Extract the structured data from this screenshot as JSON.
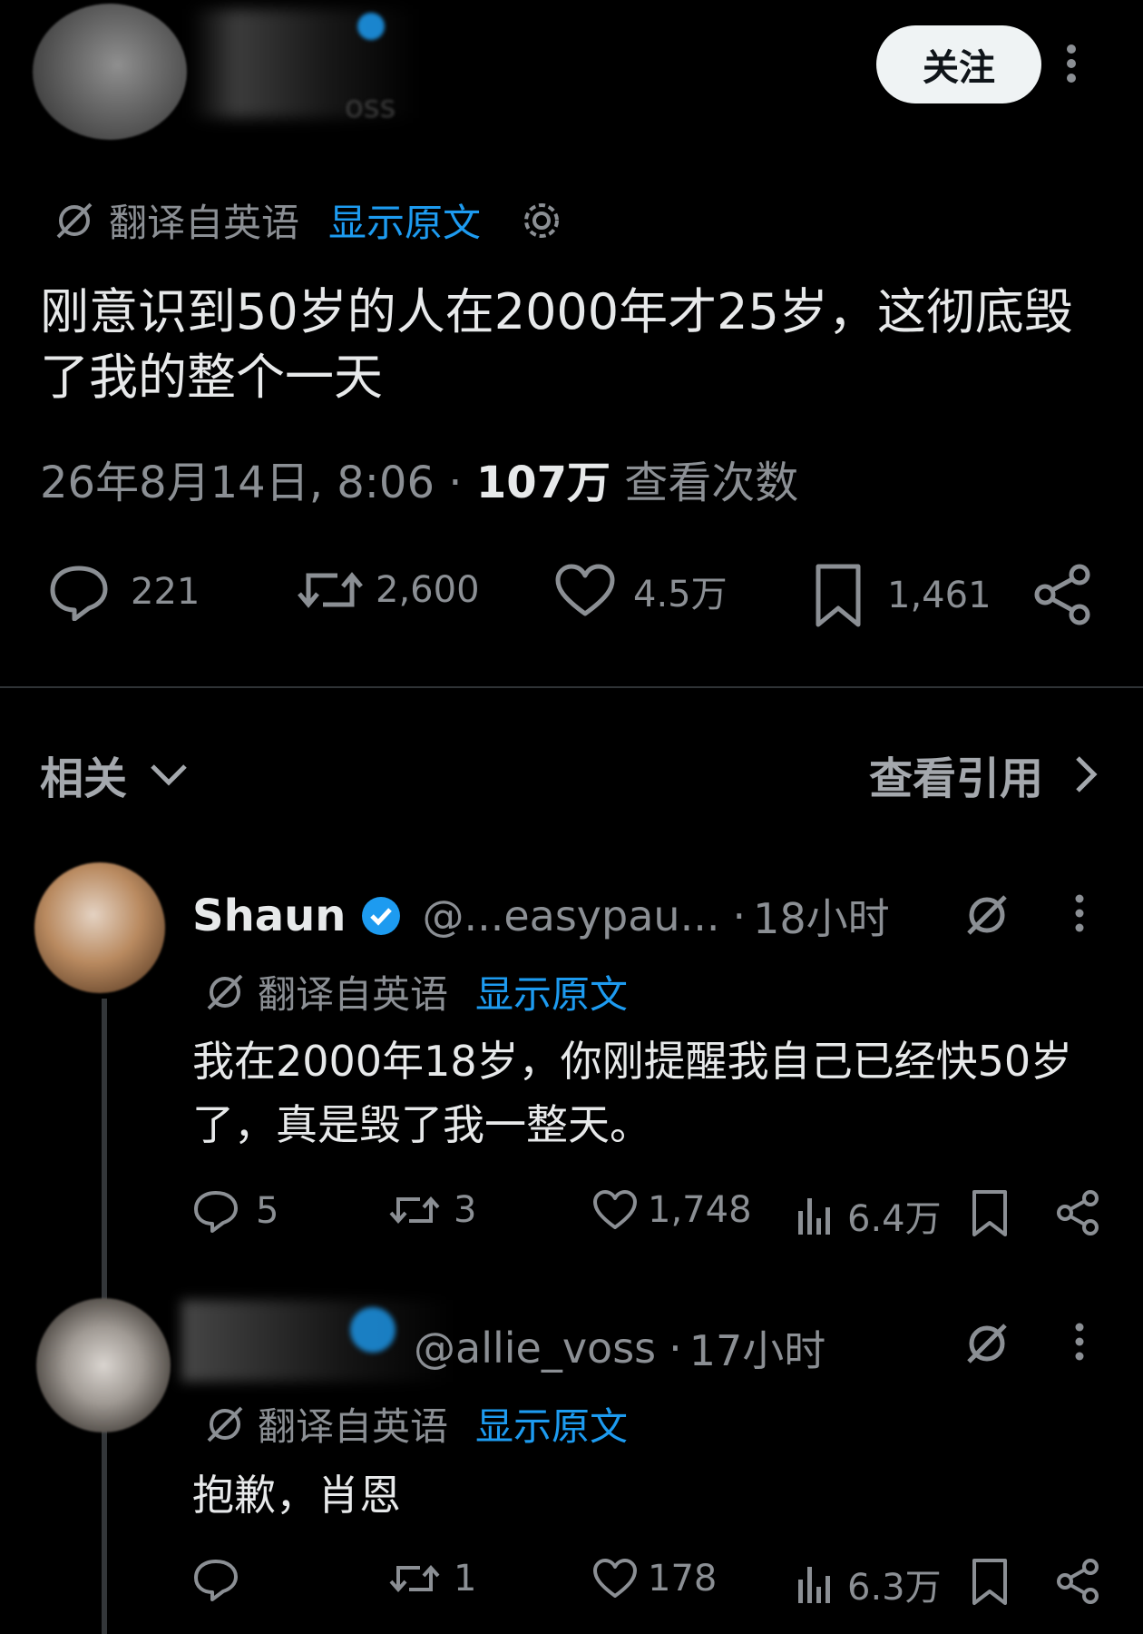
{
  "header": {
    "handle_partial": "oss",
    "follow_label": "关注"
  },
  "translate": {
    "label": "翻译自英语",
    "show_original": "显示原文"
  },
  "post": {
    "text": "刚意识到50岁的人在2000年才25岁，这彻底毁了我的整个一天",
    "date": "26年8月14日, 8:06",
    "separator": "·",
    "views_count": "107万",
    "views_label": "查看次数",
    "actions": {
      "replies": "221",
      "reposts": "2,600",
      "likes": "4.5万",
      "bookmarks": "1,461"
    }
  },
  "section": {
    "related": "相关",
    "view_quotes": "查看引用"
  },
  "replies": [
    {
      "name": "Shaun",
      "handle": "@...easypau...",
      "time": "18小时",
      "separator": "·",
      "translate_label": "翻译自英语",
      "show_original": "显示原文",
      "text": "我在2000年18岁，你刚提醒我自己已经快50岁了，真是毁了我一整天。",
      "replies": "5",
      "reposts": "3",
      "likes": "1,748",
      "views": "6.4万"
    },
    {
      "name": "",
      "handle": "@allie_voss",
      "time": "17小时",
      "separator": "·",
      "translate_label": "翻译自英语",
      "show_original": "显示原文",
      "text": "抱歉，肖恩",
      "replies": "",
      "reposts": "1",
      "likes": "178",
      "views": "6.3万"
    }
  ],
  "colors": {
    "background": "#000000",
    "text": "#e7e9ea",
    "muted": "#8b8f94",
    "accent": "#1d9bf0",
    "follow_bg": "#eff3f4"
  }
}
